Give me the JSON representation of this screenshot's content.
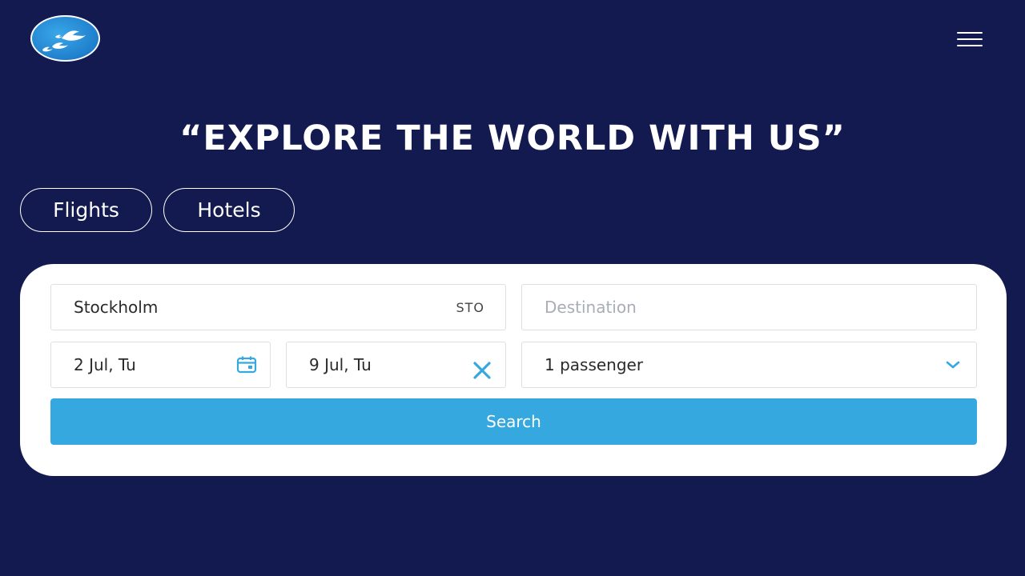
{
  "header": {
    "logo_icon": "birds-logo-icon",
    "menu_icon": "hamburger-menu-icon"
  },
  "headline": "“EXPLORE THE WORLD WITH US”",
  "tabs": [
    {
      "label": "Flights"
    },
    {
      "label": "Hotels"
    }
  ],
  "form": {
    "origin": {
      "value": "Stockholm",
      "code": "STO"
    },
    "destination": {
      "placeholder": "Destination"
    },
    "depart": {
      "value": "2 Jul, Tu",
      "icon": "calendar-icon"
    },
    "return": {
      "value": "9 Jul, Tu",
      "icon": "clear-icon"
    },
    "passengers": {
      "value": "1 passenger",
      "icon": "chevron-down-icon"
    },
    "search_label": "Search"
  },
  "colors": {
    "background": "#131a4f",
    "accent": "#35a8df",
    "card": "#ffffff"
  }
}
